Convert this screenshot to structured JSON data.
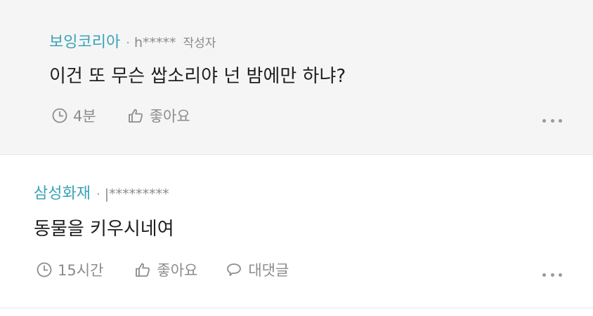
{
  "comments": [
    {
      "nickname": "보잉코리아",
      "separator": "·",
      "user_id": "h*****",
      "author_tag": "작성자",
      "text": "이건 또 무슨 쌉소리야 넌 밤에만 하냐?",
      "time": "4분",
      "like_label": "좋아요",
      "more_icon": "more-dots-icon"
    },
    {
      "nickname": "삼성화재",
      "separator": "·",
      "user_id": "|*********",
      "text": "동물을 키우시네여",
      "time": "15시간",
      "like_label": "좋아요",
      "reply_label": "대댓글",
      "more_icon": "more-dots-icon"
    }
  ],
  "colors": {
    "nickname": "#3aa3b8",
    "highlight_bg": "#f5f5f5",
    "meta_text": "#8c8c8c",
    "body_text": "#1e1e1e"
  }
}
